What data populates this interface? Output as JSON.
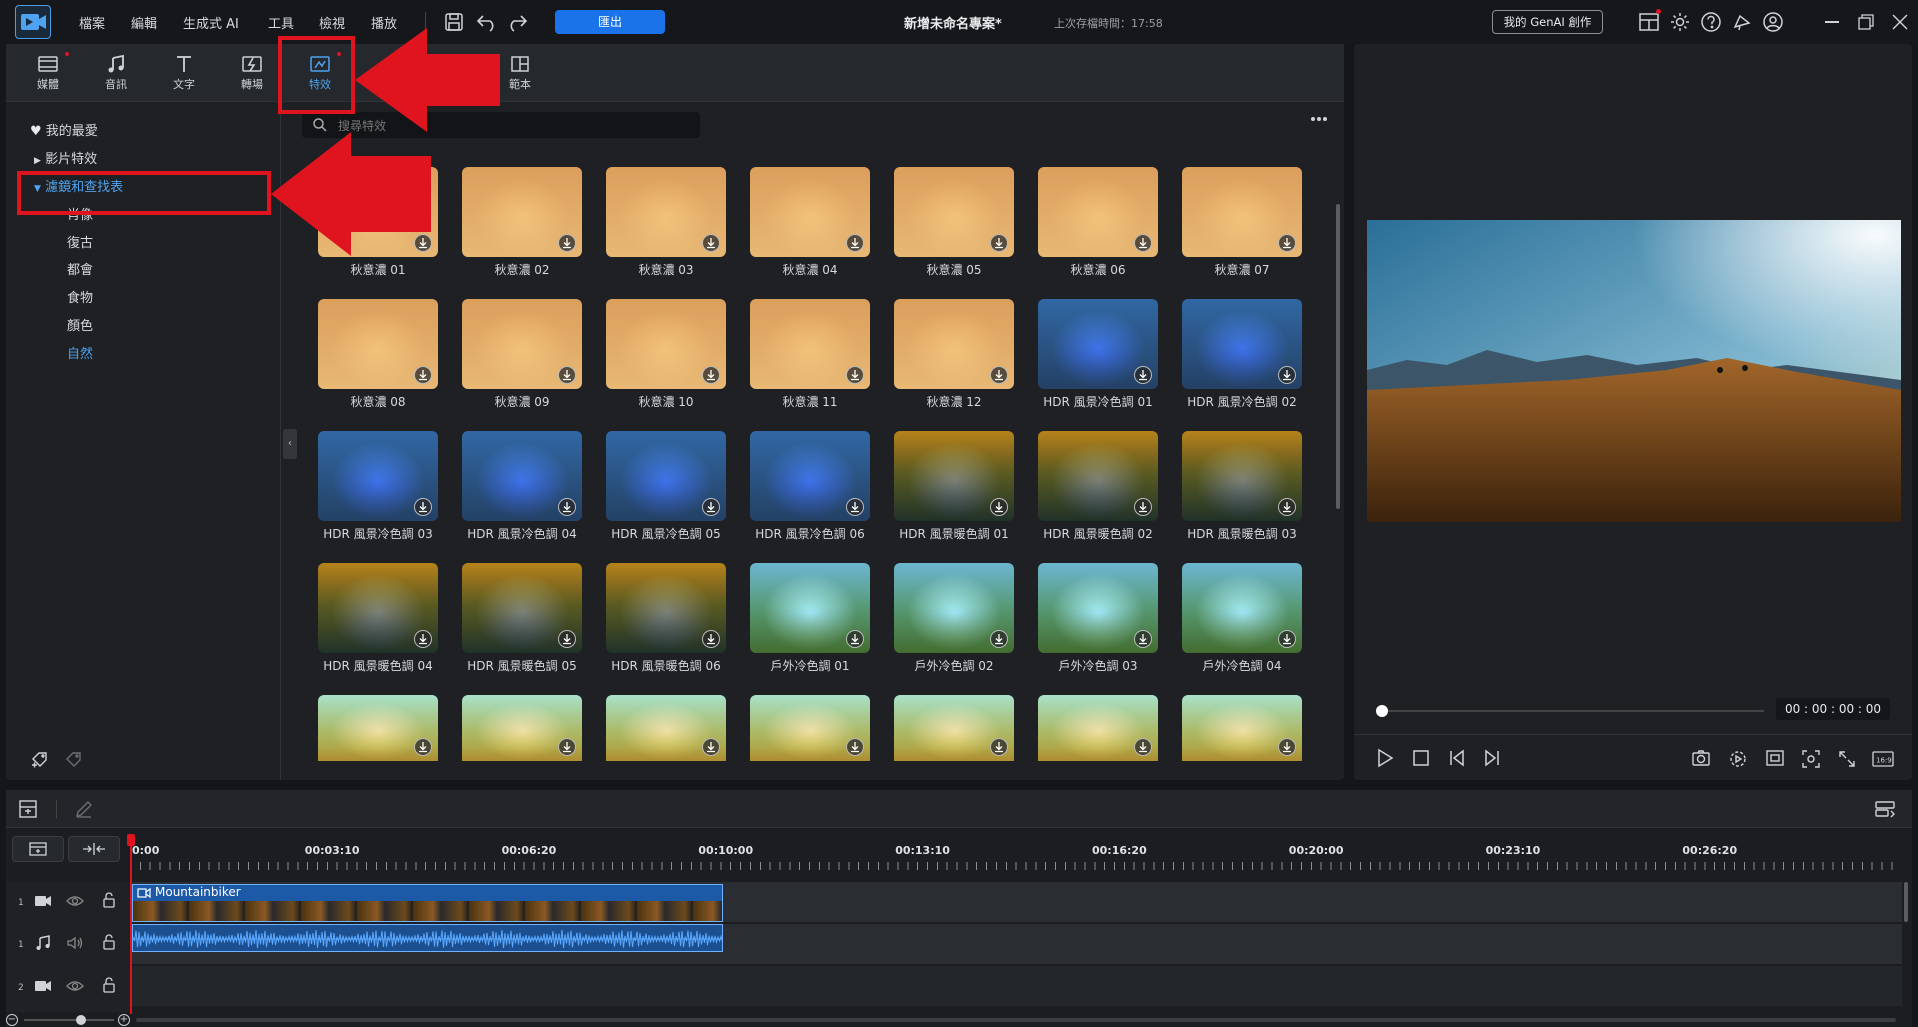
{
  "menubar": {
    "items": [
      "檔案",
      "編輯",
      "生成式 AI",
      "工具",
      "檢視",
      "播放"
    ],
    "export_label": "匯出",
    "project_title": "新增未命名專案*",
    "save_time": "上次存檔時間：17:58",
    "genai_label": "我的 GenAI 創作"
  },
  "tabs": [
    {
      "label": "媒體",
      "icon": "media-icon"
    },
    {
      "label": "音訊",
      "icon": "music-icon"
    },
    {
      "label": "文字",
      "icon": "text-icon"
    },
    {
      "label": "轉場",
      "icon": "transition-icon"
    },
    {
      "label": "特效",
      "icon": "effects-icon",
      "active": true
    },
    {
      "label": "範本",
      "icon": "template-icon"
    }
  ],
  "nav": {
    "favorites": "我的最愛",
    "video_effects": "影片特效",
    "filters_luts": "濾鏡和查找表",
    "sub": [
      "肖像",
      "復古",
      "都會",
      "食物",
      "顏色",
      "自然"
    ],
    "selected_sub": "自然"
  },
  "search": {
    "placeholder": "搜尋特效"
  },
  "effects": [
    [
      "秋意濃 01",
      "秋意濃 02",
      "秋意濃 03",
      "秋意濃 04",
      "秋意濃 05",
      "秋意濃 06",
      "秋意濃 07"
    ],
    [
      "秋意濃 08",
      "秋意濃 09",
      "秋意濃 10",
      "秋意濃 11",
      "秋意濃 12",
      "HDR 風景冷色調 01",
      "HDR 風景冷色調 02"
    ],
    [
      "HDR 風景冷色調 03",
      "HDR 風景冷色調 04",
      "HDR 風景冷色調 05",
      "HDR 風景冷色調 06",
      "HDR 風景暖色調 01",
      "HDR 風景暖色調 02",
      "HDR 風景暖色調 03"
    ],
    [
      "HDR 風景暖色調 04",
      "HDR 風景暖色調 05",
      "HDR 風景暖色調 06",
      "戶外冷色調 01",
      "戶外冷色調 02",
      "戶外冷色調 03",
      "戶外冷色調 04"
    ],
    [
      "",
      "",
      "",
      "",
      "",
      "",
      ""
    ]
  ],
  "preview": {
    "timecode": "00 : 00 : 00 : 00"
  },
  "timeline": {
    "ruler": [
      "0:00",
      "00:03:10",
      "00:06:20",
      "00:10:00",
      "00:13:10",
      "00:16:20",
      "00:20:00",
      "00:23:10",
      "00:26:20"
    ],
    "clip_name": "Mountainbiker",
    "tracks": [
      "1",
      "1",
      "2"
    ]
  },
  "colors": {
    "accent": "#1a73e8",
    "highlight": "#e0141e",
    "panel": "#1e2024"
  }
}
